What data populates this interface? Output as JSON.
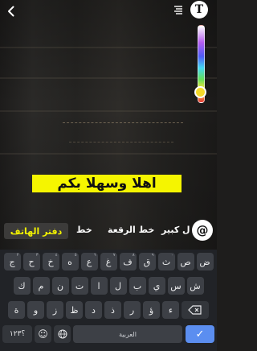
{
  "header": {
    "back_icon": "back-chevron-icon",
    "menu_icon": "text-align-icon",
    "text_tool_label": "T"
  },
  "color_slider": {
    "selected_color": "#f5d92a",
    "level": 0.82
  },
  "caption": {
    "text": "اهلا وسهلا بكم",
    "background": "#f5f500",
    "color": "#111111"
  },
  "font_bar": {
    "items": [
      "ل كبير",
      "خط الرقعة",
      "خط",
      "دفتر الهاتف"
    ],
    "selected": "دفتر الهاتف",
    "at_label": "@"
  },
  "keyboard": {
    "row1": [
      {
        "key": "ج",
        "hint": "٢"
      },
      {
        "key": "ح",
        "hint": "٣"
      },
      {
        "key": "خ",
        "hint": "٤"
      },
      {
        "key": "ه",
        "hint": "٥"
      },
      {
        "key": "ع",
        "hint": "٦"
      },
      {
        "key": "غ",
        "hint": "٧"
      },
      {
        "key": "ف",
        "hint": "٨"
      },
      {
        "key": "ق",
        "hint": "٩"
      },
      {
        "key": "ث",
        "hint": "٠"
      },
      {
        "key": "ص",
        "hint": ""
      },
      {
        "key": "ض",
        "hint": ""
      }
    ],
    "row2": [
      "ك",
      "م",
      "ن",
      "ت",
      "ا",
      "ل",
      "ب",
      "ي",
      "س",
      "ش"
    ],
    "row3": [
      "ة",
      "و",
      "ز",
      "ظ",
      "د",
      "ذ",
      "ر",
      "ؤ",
      "ء"
    ],
    "row4": {
      "numbers_label": "؟١٢٣",
      "emoji_label": "☺",
      "globe_label": "🌐",
      "space_label": "العربية",
      "enter_label": "✓"
    }
  }
}
